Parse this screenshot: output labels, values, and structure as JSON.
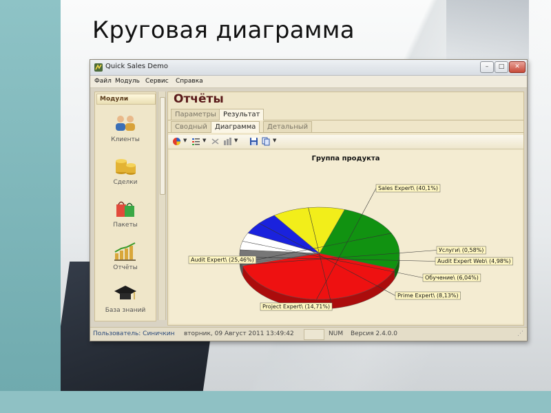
{
  "slide": {
    "title": "Круговая диаграмма"
  },
  "window": {
    "title": "Quick Sales Demo",
    "menu": [
      "Файл",
      "Модуль",
      "Сервис",
      "Справка"
    ],
    "controls": {
      "minimize": "–",
      "maximize": "□",
      "close": "✕"
    }
  },
  "sidebar": {
    "header": "Модули",
    "items": [
      {
        "label": "Клиенты",
        "icon": "clients-icon"
      },
      {
        "label": "Сделки",
        "icon": "deals-icon"
      },
      {
        "label": "Пакеты",
        "icon": "packages-icon"
      },
      {
        "label": "Отчёты",
        "icon": "reports-icon"
      },
      {
        "label": "База знаний",
        "icon": "knowledge-base-icon"
      }
    ]
  },
  "main": {
    "title": "Отчёты",
    "tabs_top": [
      {
        "label": "Параметры",
        "active": false
      },
      {
        "label": "Результат",
        "active": true
      }
    ],
    "tabs_sub": [
      {
        "label": "Сводный",
        "active": false
      },
      {
        "label": "Диаграмма",
        "active": true
      },
      {
        "label": "Детальный",
        "active": false
      }
    ]
  },
  "chart_data": {
    "type": "pie",
    "title": "Группа продукта",
    "slices": [
      {
        "label": "Sales Expert\\ (40,1%)",
        "value": 40.1,
        "color": "#ee1111"
      },
      {
        "label": "Услуги\\ (0,58%)",
        "value": 0.58,
        "color": "#888888"
      },
      {
        "label": "Audit Expert Web\\ (4,98%)",
        "value": 4.98,
        "color": "#777777"
      },
      {
        "label": "Обучение\\ (6,04%)",
        "value": 6.04,
        "color": "#ffffff"
      },
      {
        "label": "Prime Expert\\ (8,13%)",
        "value": 8.13,
        "color": "#1a22dd"
      },
      {
        "label": "Project Expert\\ (14,71%)",
        "value": 14.71,
        "color": "#f2ee1a"
      },
      {
        "label": "Audit Expert\\ (25,46%)",
        "value": 25.46,
        "color": "#119211"
      }
    ]
  },
  "status": {
    "user": "Пользователь: Синичкин",
    "datetime": "вторник, 09 Август 2011 13:49:42",
    "num": "NUM",
    "version": "Версия 2.4.0.0"
  }
}
